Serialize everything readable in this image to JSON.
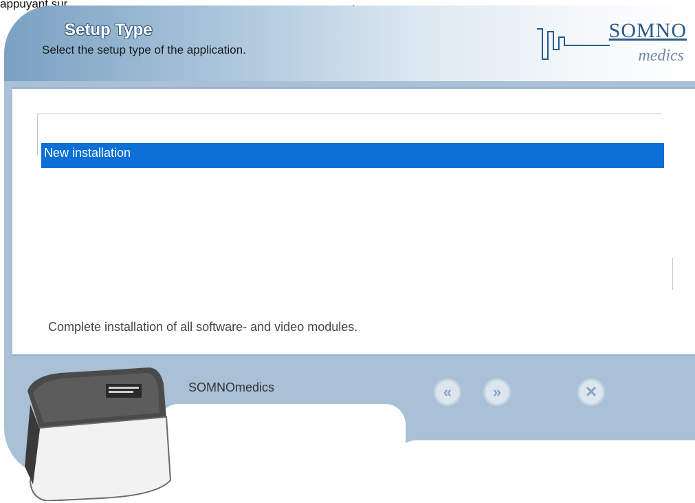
{
  "document": {
    "preceding_text": "appuyant sur",
    "trailing_text": "."
  },
  "header": {
    "title": "Setup Type",
    "subtitle": "Select the setup type of the application."
  },
  "logo": {
    "word1": "SOMNO",
    "word2": "medics"
  },
  "setup_types": {
    "selected": "New installation"
  },
  "description": "Complete installation of all software- and video modules.",
  "footer": {
    "company_label": "SOMNOmedics"
  },
  "nav": {
    "back_icon": "«",
    "next_icon": "»",
    "close_icon": "✕"
  },
  "colors": {
    "selection": "#0a6fd6",
    "frame": "#a9c0d7",
    "accent": "#2a5a8a"
  }
}
